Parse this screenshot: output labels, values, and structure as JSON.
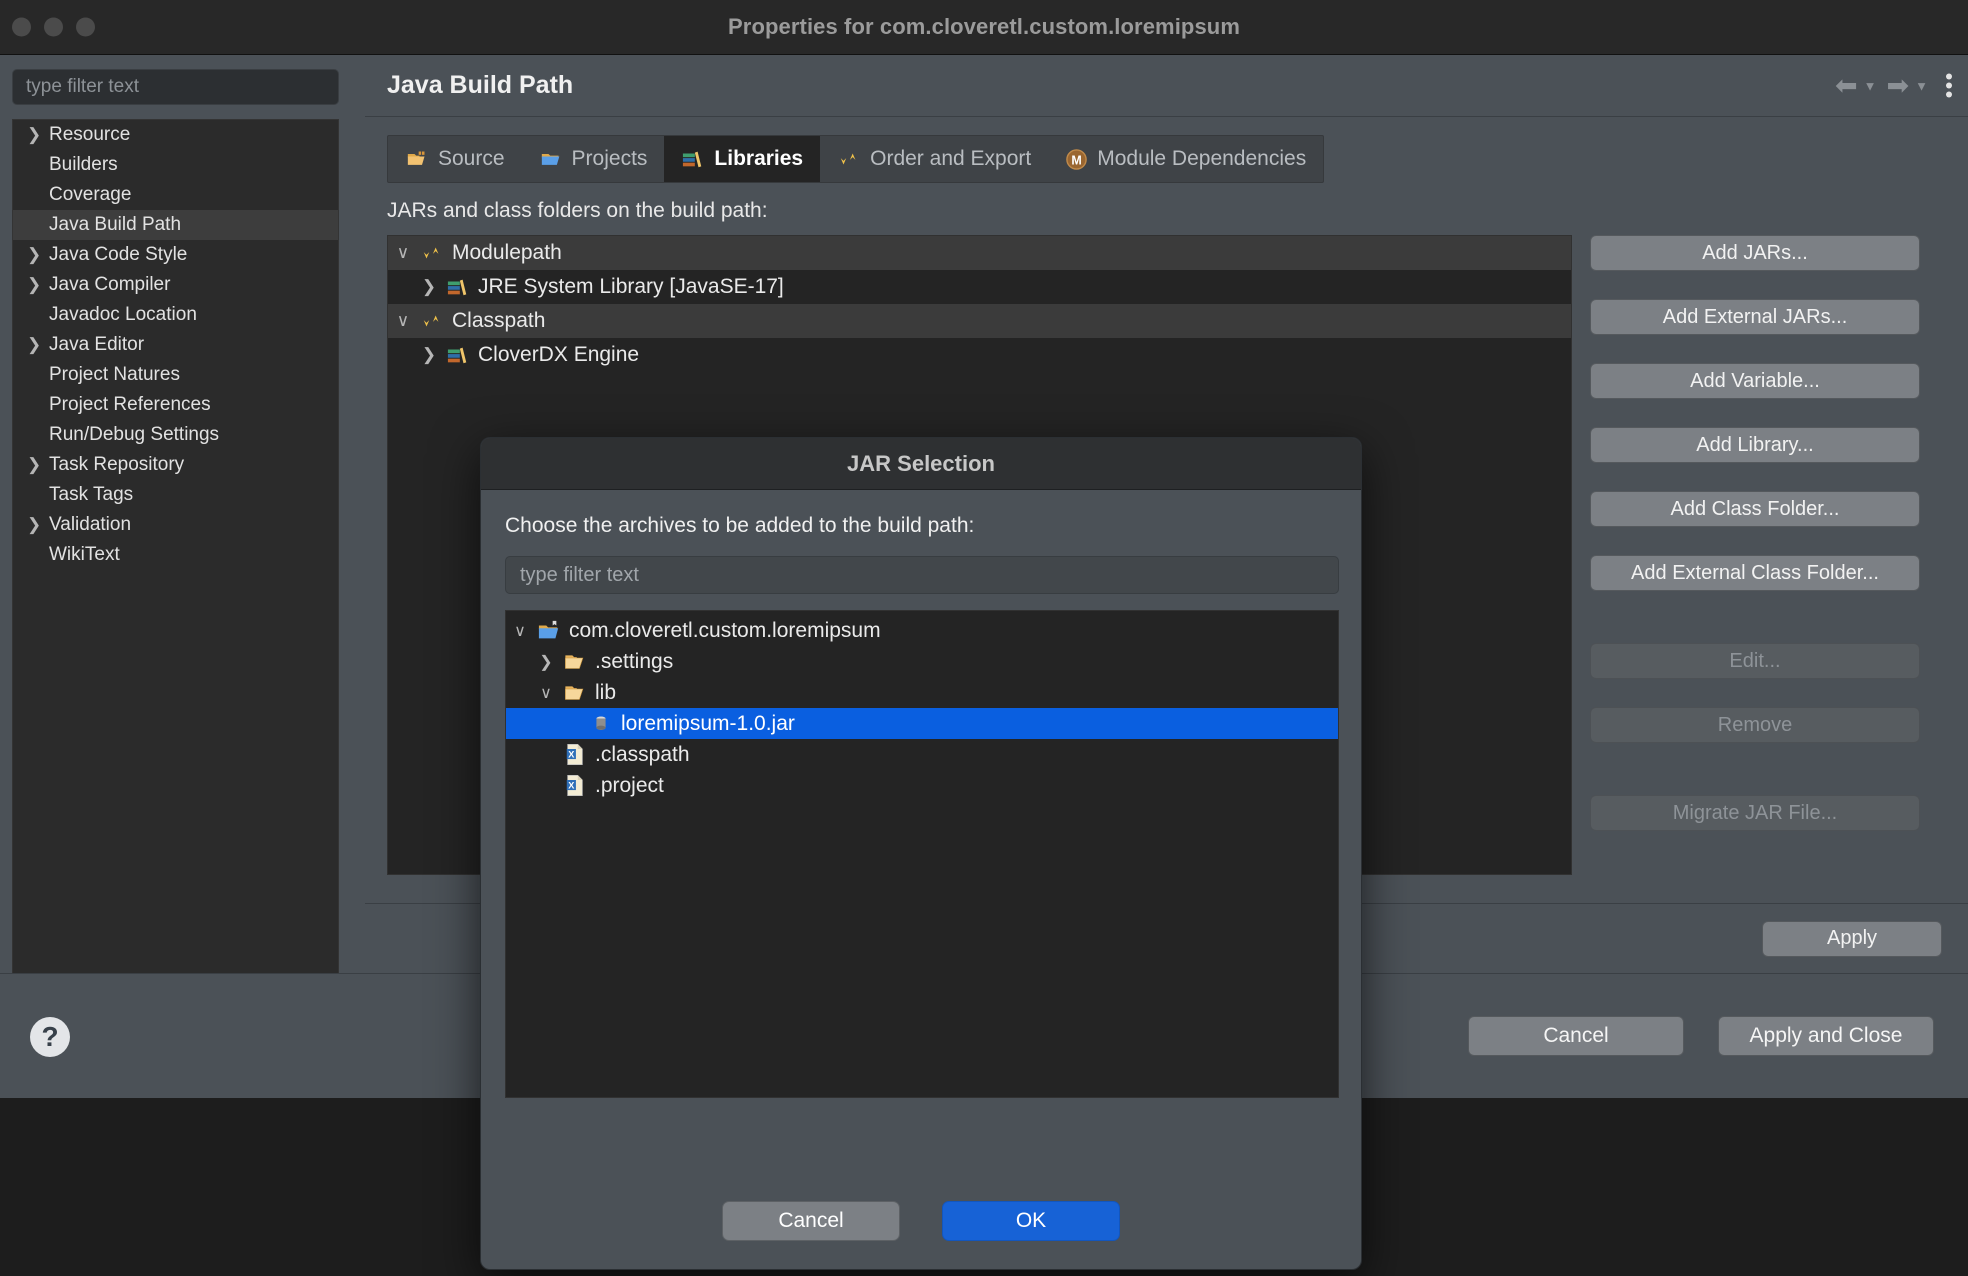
{
  "window": {
    "title": "Properties for com.cloveretl.custom.loremipsum"
  },
  "sidebar": {
    "filter_placeholder": "type filter text",
    "items": [
      {
        "label": "Resource",
        "expandable": true,
        "selected": false
      },
      {
        "label": "Builders",
        "expandable": false,
        "selected": false
      },
      {
        "label": "Coverage",
        "expandable": false,
        "selected": false
      },
      {
        "label": "Java Build Path",
        "expandable": false,
        "selected": true
      },
      {
        "label": "Java Code Style",
        "expandable": true,
        "selected": false
      },
      {
        "label": "Java Compiler",
        "expandable": true,
        "selected": false
      },
      {
        "label": "Javadoc Location",
        "expandable": false,
        "selected": false
      },
      {
        "label": "Java Editor",
        "expandable": true,
        "selected": false
      },
      {
        "label": "Project Natures",
        "expandable": false,
        "selected": false
      },
      {
        "label": "Project References",
        "expandable": false,
        "selected": false
      },
      {
        "label": "Run/Debug Settings",
        "expandable": false,
        "selected": false
      },
      {
        "label": "Task Repository",
        "expandable": true,
        "selected": false
      },
      {
        "label": "Task Tags",
        "expandable": false,
        "selected": false
      },
      {
        "label": "Validation",
        "expandable": true,
        "selected": false
      },
      {
        "label": "WikiText",
        "expandable": false,
        "selected": false
      }
    ]
  },
  "page": {
    "title": "Java Build Path",
    "nav": {
      "back_icon": "arrow-left-icon",
      "forward_icon": "arrow-right-icon",
      "menu_icon": "kebab-menu-icon"
    }
  },
  "tabs": [
    {
      "label": "Source",
      "icon": "source-folder-icon",
      "active": false
    },
    {
      "label": "Projects",
      "icon": "projects-folder-icon",
      "active": false
    },
    {
      "label": "Libraries",
      "icon": "libraries-books-icon",
      "active": true
    },
    {
      "label": "Order and Export",
      "icon": "order-export-arrows-icon",
      "active": false
    },
    {
      "label": "Module Dependencies",
      "icon": "module-m-icon",
      "active": false
    }
  ],
  "libraries": {
    "label": "JARs and class folders on the build path:",
    "nodes": [
      {
        "label": "Modulepath",
        "level": 0,
        "icon": "path-arrows-icon",
        "caret": "down",
        "highlight": true
      },
      {
        "label": "JRE System Library [JavaSE-17]",
        "level": 1,
        "icon": "library-books-icon",
        "caret": "right",
        "highlight": false
      },
      {
        "label": "Classpath",
        "level": 0,
        "icon": "path-arrows-icon",
        "caret": "down",
        "highlight": true
      },
      {
        "label": "CloverDX Engine",
        "level": 1,
        "icon": "library-books-icon",
        "caret": "right",
        "highlight": false
      }
    ],
    "buttons": [
      {
        "label": "Add JARs...",
        "disabled": false,
        "gap": false
      },
      {
        "label": "Add External JARs...",
        "disabled": false,
        "gap": false
      },
      {
        "label": "Add Variable...",
        "disabled": false,
        "gap": false
      },
      {
        "label": "Add Library...",
        "disabled": false,
        "gap": false
      },
      {
        "label": "Add Class Folder...",
        "disabled": false,
        "gap": false
      },
      {
        "label": "Add External Class Folder...",
        "disabled": false,
        "gap": false
      },
      {
        "label": "Edit...",
        "disabled": true,
        "gap": true
      },
      {
        "label": "Remove",
        "disabled": true,
        "gap": false
      },
      {
        "label": "Migrate JAR File...",
        "disabled": true,
        "gap": true
      }
    ],
    "apply_label": "Apply"
  },
  "footer": {
    "help_icon": "help-question-icon",
    "cancel_label": "Cancel",
    "apply_close_label": "Apply and Close"
  },
  "dialog": {
    "title": "JAR Selection",
    "prompt": "Choose the archives to be added to the build path:",
    "filter_placeholder": "type filter text",
    "tree": [
      {
        "label": "com.cloveretl.custom.loremipsum",
        "level": 0,
        "icon": "project-folder-icon",
        "caret": "down",
        "selected": false
      },
      {
        "label": ".settings",
        "level": 1,
        "icon": "folder-icon",
        "caret": "right",
        "selected": false
      },
      {
        "label": "lib",
        "level": 1,
        "icon": "folder-icon",
        "caret": "down",
        "selected": false
      },
      {
        "label": "loremipsum-1.0.jar",
        "level": 2,
        "icon": "jar-icon",
        "caret": "none",
        "selected": true
      },
      {
        "label": ".classpath",
        "level": 1,
        "icon": "xml-file-icon",
        "caret": "none",
        "selected": false
      },
      {
        "label": ".project",
        "level": 1,
        "icon": "xml-file-icon",
        "caret": "none",
        "selected": false
      }
    ],
    "cancel_label": "Cancel",
    "ok_label": "OK"
  },
  "colors": {
    "selection_blue": "#0a5fe0",
    "ok_button_blue": "#1762d6",
    "chrome_gray": "#4b5157",
    "tree_background": "#242424"
  }
}
